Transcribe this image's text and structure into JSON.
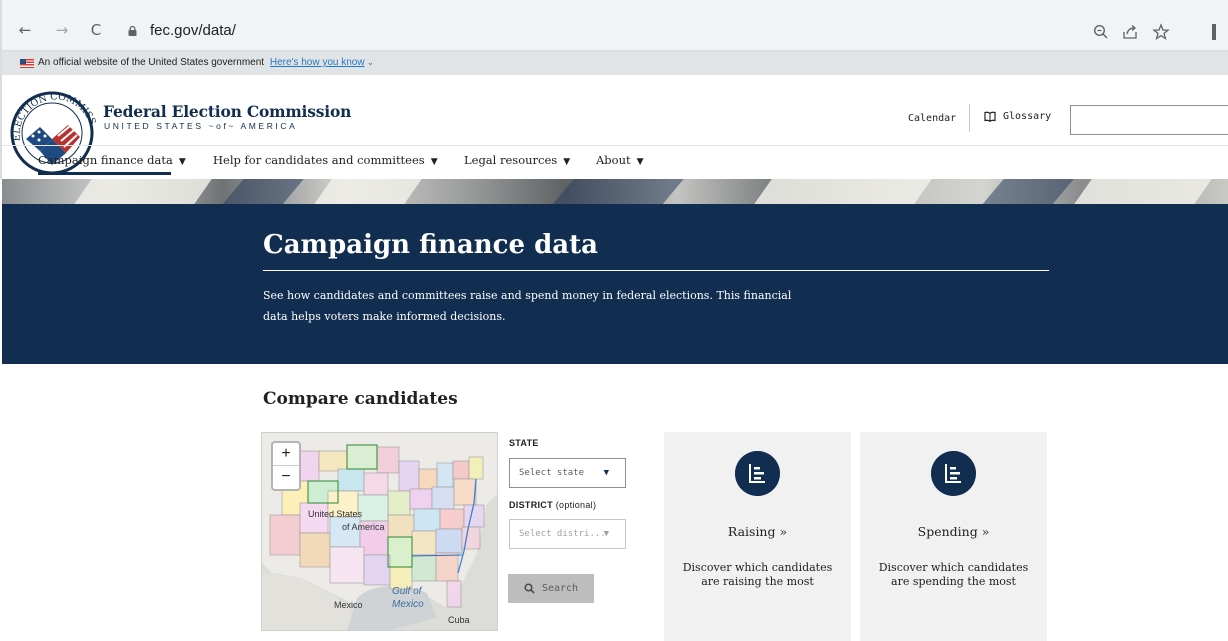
{
  "browser": {
    "url": "fec.gov/data/",
    "icons": [
      "back-icon",
      "forward-icon",
      "reload-icon",
      "lock-icon",
      "zoom-icon",
      "share-icon",
      "star-icon"
    ]
  },
  "gov_banner": {
    "text": "An official website of the United States government",
    "link": "Here's how you know"
  },
  "header": {
    "title": "Federal Election Commission",
    "subtitle": "UNITED STATES ~of~ AMERICA",
    "seal_text": "ELECTION COMMISSION",
    "calendar": "Calendar",
    "glossary": "Glossary",
    "search_value": ""
  },
  "nav": {
    "items": [
      {
        "label": "Campaign finance data",
        "active": true
      },
      {
        "label": "Help for candidates and committees",
        "active": false
      },
      {
        "label": "Legal resources",
        "active": false
      },
      {
        "label": "About",
        "active": false
      }
    ],
    "caret": "▼"
  },
  "hero": {
    "title": "Campaign finance data",
    "description": "See how candidates and committees raise and spend money in federal elections. This financial data helps voters make informed decisions."
  },
  "compare": {
    "title": "Compare candidates",
    "map": {
      "zoom_in": "+",
      "zoom_out": "−",
      "country": "United States",
      "country2": "of America",
      "mexico": "Mexico",
      "gulf1": "Gulf of",
      "gulf2": "Mexico",
      "cuba": "Cuba"
    },
    "state_label": "STATE",
    "state_placeholder": "Select state",
    "district_label": "DISTRICT",
    "district_optional": "(optional)",
    "district_placeholder": "Select distri...",
    "search_button": "Search",
    "cards": [
      {
        "title": "Raising »",
        "description": "Discover which candidates are raising the most"
      },
      {
        "title": "Spending »",
        "description": "Discover which candidates are spending the most"
      }
    ]
  },
  "colors": {
    "navy": "#112e51",
    "card_bg": "#f1f1f1",
    "link_blue": "#2378c3"
  }
}
